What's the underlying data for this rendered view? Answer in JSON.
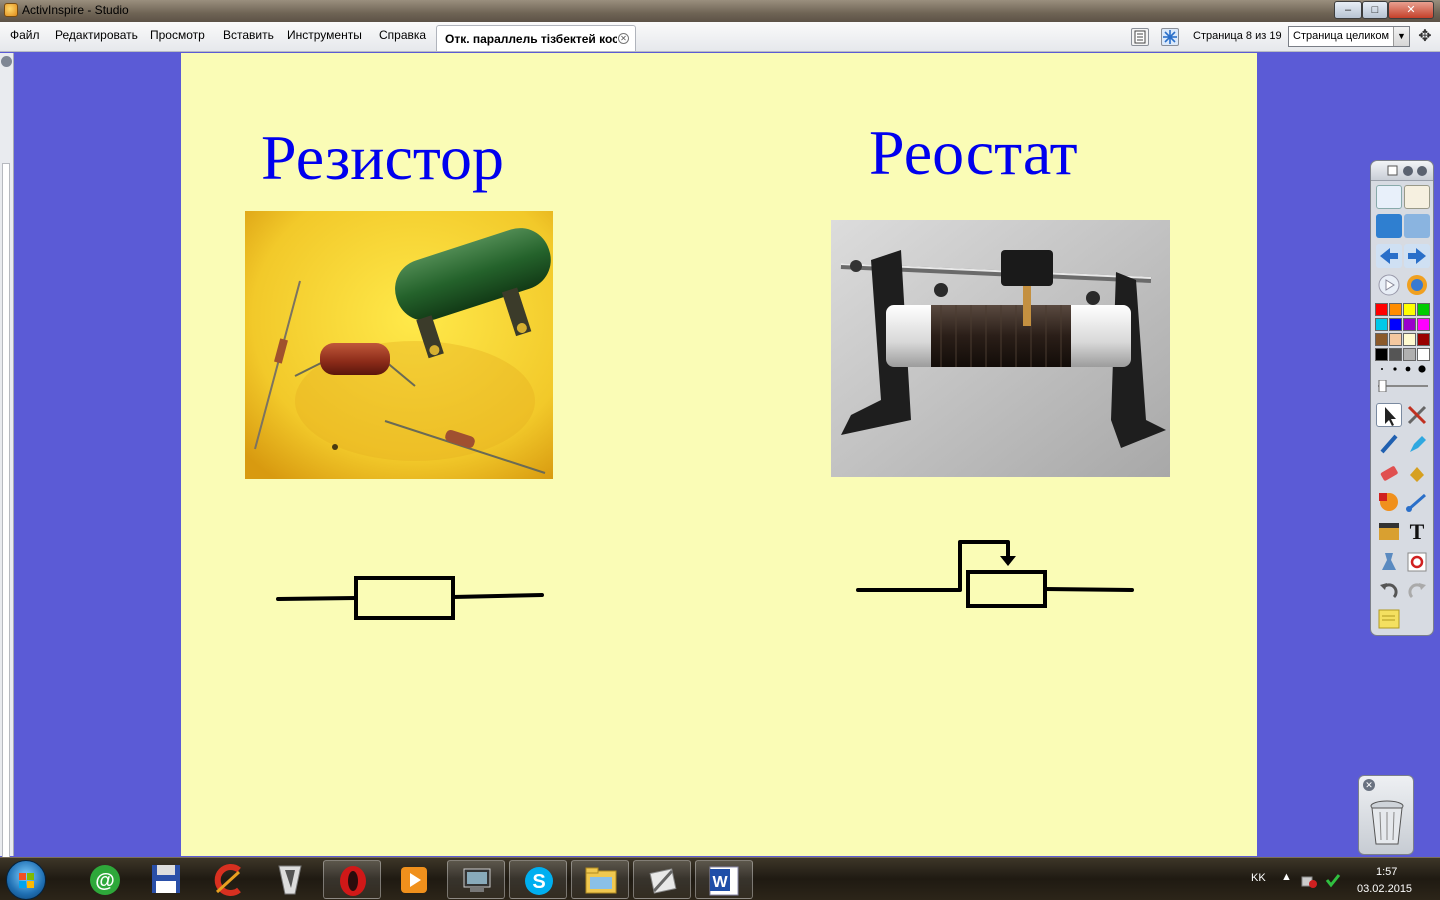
{
  "window": {
    "title": "ActivInspire - Studio"
  },
  "menu": {
    "items": [
      "Файл",
      "Редактировать",
      "Просмотр",
      "Вставить",
      "Инструменты",
      "Справка"
    ],
    "doc_tab": "Отк. параллель  тізбектей кос"
  },
  "page_nav": {
    "page_info": "Страница 8 из 19",
    "zoom": "Страница целиком"
  },
  "flipchart": {
    "background": "#fafcb6",
    "heading_color": "#0000ee",
    "left": {
      "heading": "Резистор",
      "photo": "resistors-photo",
      "symbol": "resistor-symbol"
    },
    "right": {
      "heading": "Реостат",
      "photo": "rheostat-photo",
      "symbol": "rheostat-symbol"
    }
  },
  "toolbox": {
    "palette": [
      "#ff0000",
      "#ff8c00",
      "#ffff00",
      "#00cc00",
      "#00c8e8",
      "#0000ff",
      "#9900cc",
      "#ff00ff",
      "#8b5a2b",
      "#f4c8a0",
      "#fffbd0",
      "#990000",
      "#000000",
      "#555555",
      "#b0b0b0",
      "#ffffff"
    ]
  },
  "taskbar": {
    "language": "KK",
    "time": "1:57",
    "date": "03.02.2015"
  }
}
